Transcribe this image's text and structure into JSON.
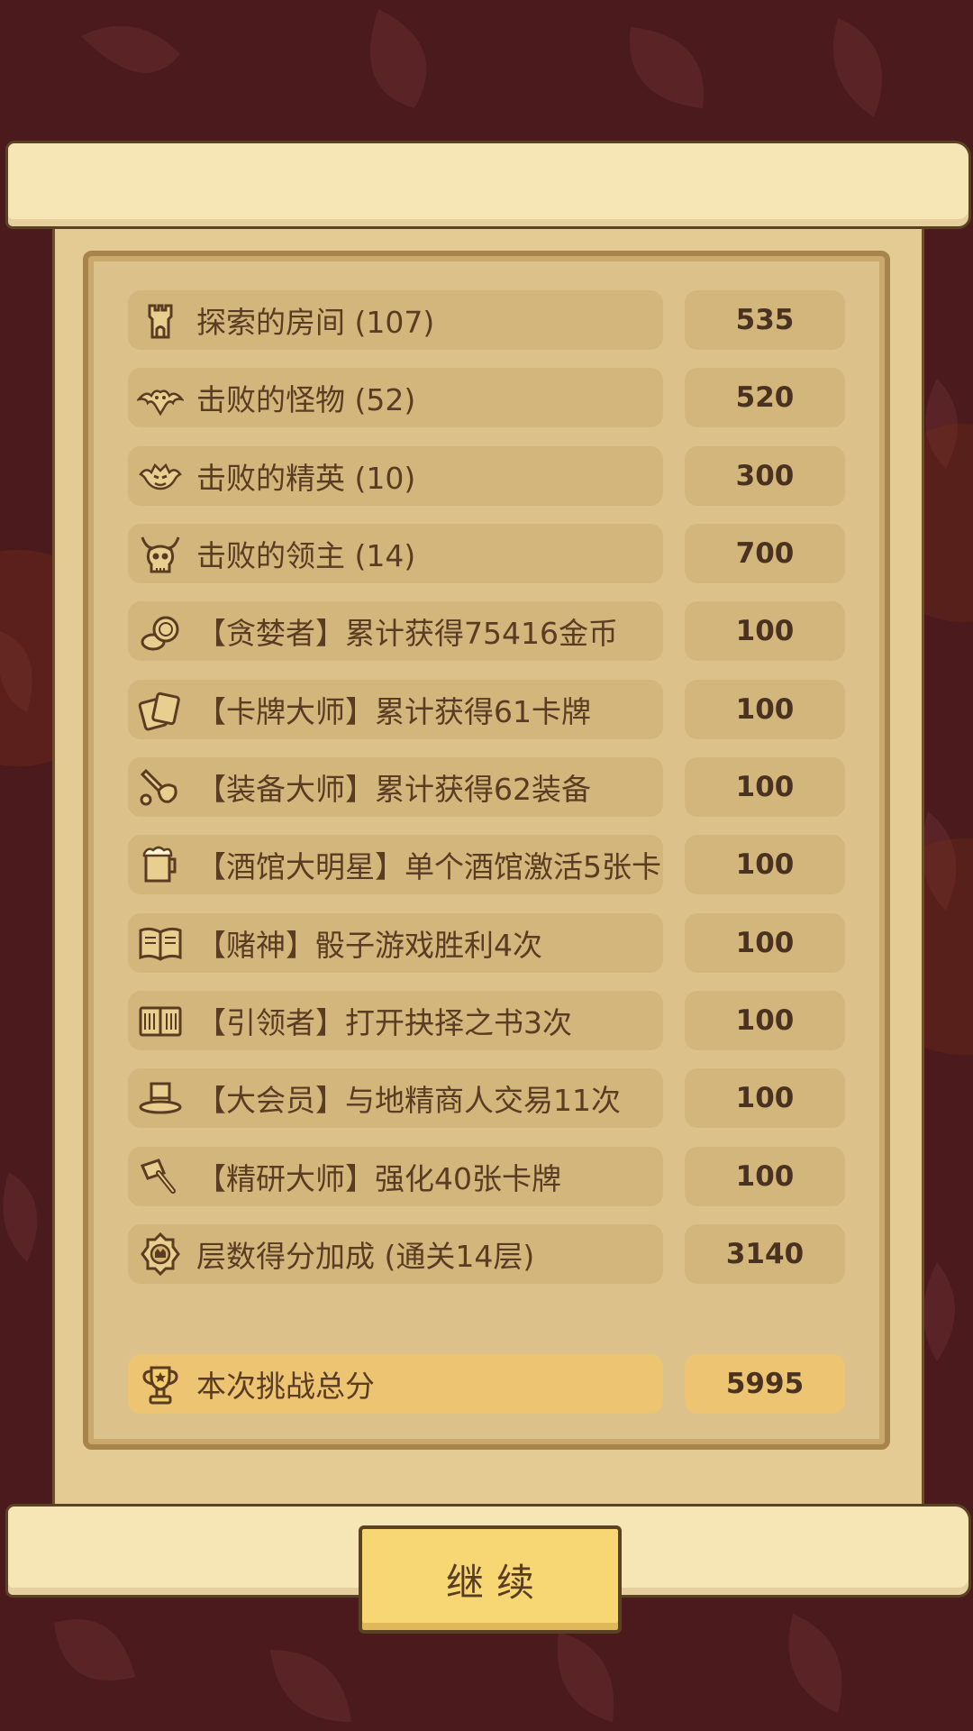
{
  "rows": [
    {
      "label": "探索的房间 (107)",
      "value": "535",
      "icon": "castle-tower-icon"
    },
    {
      "label": "击败的怪物 (52)",
      "value": "520",
      "icon": "bat-icon"
    },
    {
      "label": "击败的精英 (10)",
      "value": "300",
      "icon": "elite-demon-icon"
    },
    {
      "label": "击败的领主 (14)",
      "value": "700",
      "icon": "boss-skull-icon"
    },
    {
      "label": "【贪婪者】累计获得75416金币",
      "value": "100",
      "icon": "coins-icon"
    },
    {
      "label": "【卡牌大师】累计获得61卡牌",
      "value": "100",
      "icon": "cards-icon"
    },
    {
      "label": "【装备大师】累计获得62装备",
      "value": "100",
      "icon": "equipment-icon"
    },
    {
      "label": "【酒馆大明星】单个酒馆激活5张卡",
      "value": "100",
      "icon": "beer-mug-icon"
    },
    {
      "label": "【赌神】骰子游戏胜利4次",
      "value": "100",
      "icon": "open-book-icon"
    },
    {
      "label": "【引领者】打开抉择之书3次",
      "value": "100",
      "icon": "book-icon"
    },
    {
      "label": "【大会员】与地精商人交易11次",
      "value": "100",
      "icon": "top-hat-icon"
    },
    {
      "label": "【精研大师】强化40张卡牌",
      "value": "100",
      "icon": "hammer-icon"
    },
    {
      "label": "层数得分加成 (通关14层)",
      "value": "3140",
      "icon": "floor-badge-icon"
    }
  ],
  "total": {
    "label": "本次挑战总分",
    "value": "5995",
    "icon": "trophy-icon"
  },
  "continue_label": "继续"
}
